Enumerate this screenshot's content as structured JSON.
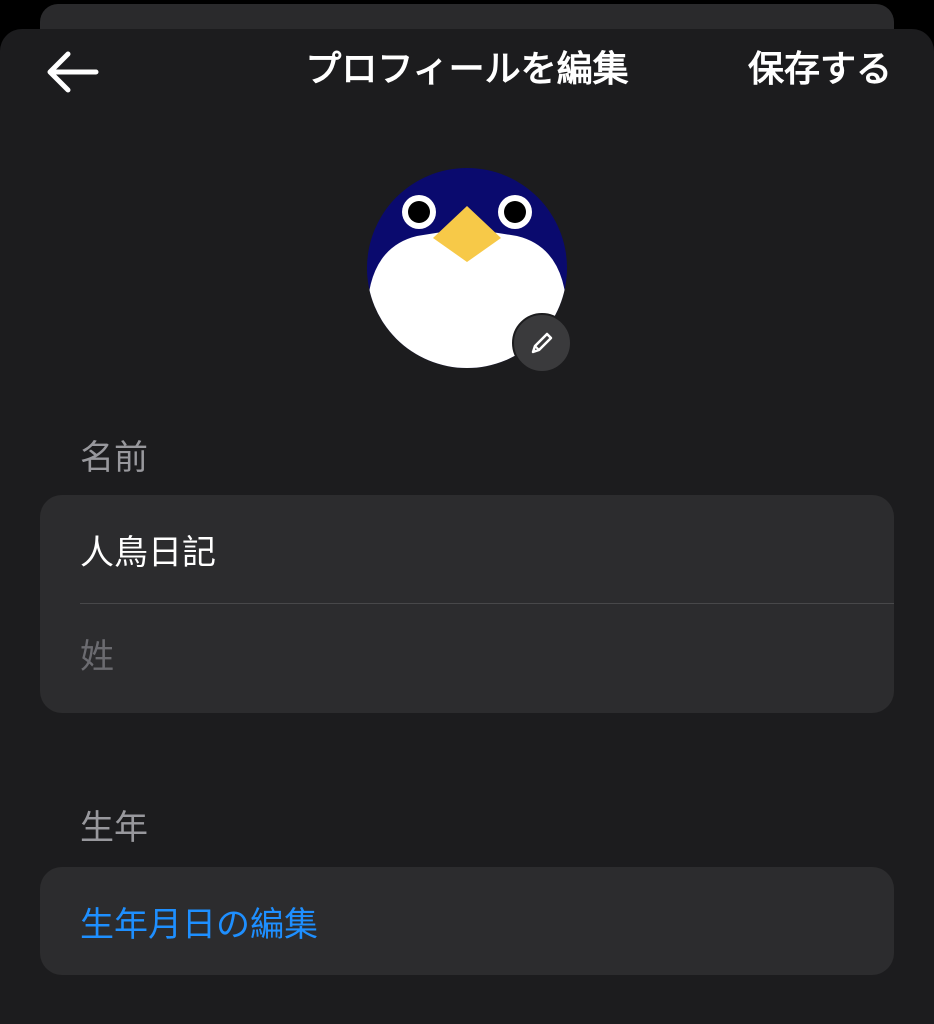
{
  "header": {
    "title": "プロフィールを編集",
    "save_label": "保存する",
    "back_icon": "arrow-left-icon"
  },
  "avatar": {
    "icon": "penguin-avatar",
    "edit_icon": "pencil-icon",
    "colors": {
      "body": "#0a0a6e",
      "belly": "#ffffff",
      "beak": "#f7c948",
      "eye": "#000000"
    }
  },
  "name_section": {
    "label": "名前",
    "first_name_value": "人鳥日記",
    "last_name_placeholder": "姓"
  },
  "birthday_section": {
    "label": "生年",
    "edit_link": "生年月日の編集"
  },
  "colors": {
    "background": "#1c1c1e",
    "card": "#2c2c2e",
    "accent": "#1e8fff",
    "secondary_text": "#98989d"
  }
}
